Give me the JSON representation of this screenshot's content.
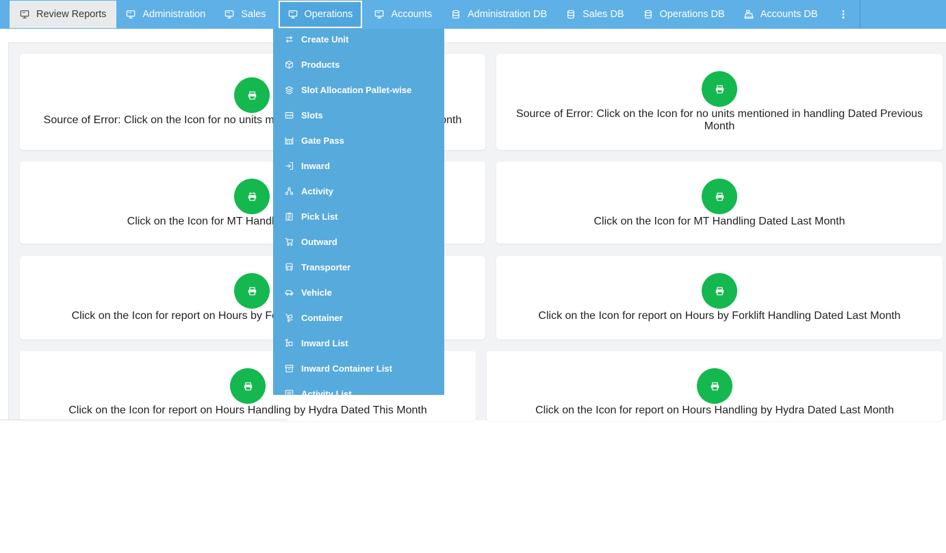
{
  "nav": {
    "items": [
      {
        "label": "Review Reports",
        "icon": "monitor-icon"
      },
      {
        "label": "Administration",
        "icon": "monitor-icon"
      },
      {
        "label": "Sales",
        "icon": "monitor-icon"
      },
      {
        "label": "Operations",
        "icon": "monitor-icon"
      },
      {
        "label": "Accounts",
        "icon": "monitor-icon"
      },
      {
        "label": "Administration DB",
        "icon": "database-icon"
      },
      {
        "label": "Sales DB",
        "icon": "database-icon"
      },
      {
        "label": "Operations DB",
        "icon": "database-icon"
      },
      {
        "label": "Accounts DB",
        "icon": "cash-register-icon"
      }
    ],
    "more_icon": "kebab-menu-icon"
  },
  "operations_menu": {
    "items": [
      {
        "label": "Create Unit",
        "icon": "exchange-arrows-icon"
      },
      {
        "label": "Products",
        "icon": "box-icon"
      },
      {
        "label": "Slot Allocation Pallet-wise",
        "icon": "boxes-icon"
      },
      {
        "label": "Slots",
        "icon": "slots-icon"
      },
      {
        "label": "Gate Pass",
        "icon": "gate-icon"
      },
      {
        "label": "Inward",
        "icon": "sign-in-icon"
      },
      {
        "label": "Activity",
        "icon": "network-icon"
      },
      {
        "label": "Pick List",
        "icon": "clipboard-list-icon"
      },
      {
        "label": "Outward",
        "icon": "cart-icon"
      },
      {
        "label": "Transporter",
        "icon": "bus-icon"
      },
      {
        "label": "Vehicle",
        "icon": "car-icon"
      },
      {
        "label": "Container",
        "icon": "dolly-icon"
      },
      {
        "label": "Inward List",
        "icon": "people-carry-icon"
      },
      {
        "label": "Inward Container List",
        "icon": "archive-icon"
      },
      {
        "label": "Activity List",
        "icon": "list-icon"
      }
    ]
  },
  "cards": [
    {
      "text": "Source of Error: Click on the Icon for no units mentioned in handling Dated This Month",
      "icon": "print-icon"
    },
    {
      "text": "Source of Error: Click on the Icon for no units mentioned in handling Dated Previous Month",
      "icon": "print-icon"
    },
    {
      "text": "Click on the Icon for MT Handling Dated This Month",
      "icon": "print-icon"
    },
    {
      "text": "Click on the Icon for MT Handling Dated Last Month",
      "icon": "print-icon"
    },
    {
      "text": "Click on the Icon for report on Hours by Forklift Handling Dated This Month",
      "icon": "print-icon"
    },
    {
      "text": "Click on the Icon for report on Hours by Forklift Handling Dated Last Month",
      "icon": "print-icon"
    },
    {
      "text": "Click on the Icon for report on Hours Handling by Hydra Dated This Month",
      "icon": "print-icon"
    },
    {
      "text": "Click on the Icon for report on Hours Handling by Hydra Dated Last Month",
      "icon": "print-icon"
    }
  ],
  "colors": {
    "nav_bg": "#5fb0e6",
    "dropdown_bg": "#57aadc",
    "action_green": "#14b84e",
    "page_bg": "#f2f3f5"
  }
}
